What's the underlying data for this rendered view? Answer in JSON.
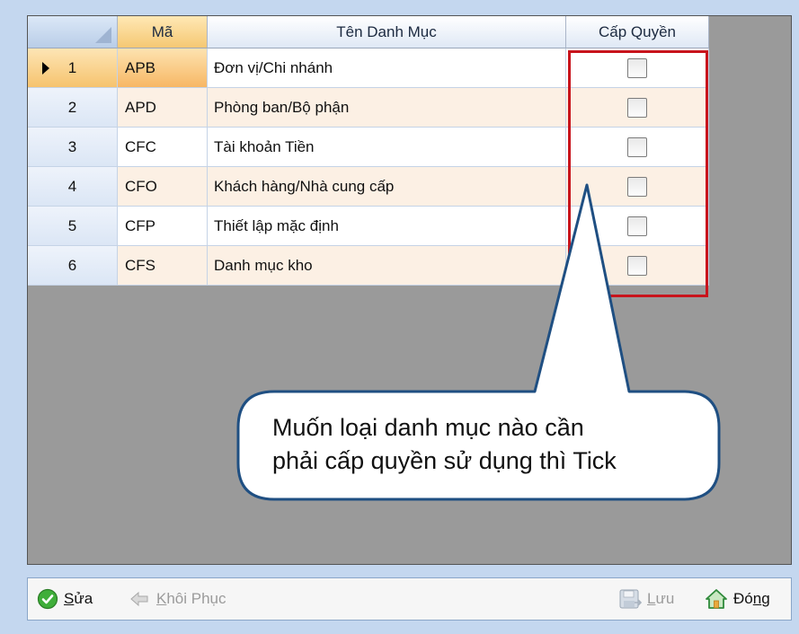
{
  "columns": {
    "ma": "Mã",
    "ten": "Tên Danh Mục",
    "cap_quyen": "Cấp Quyền"
  },
  "rows": [
    {
      "no": "1",
      "ma": "APB",
      "ten": "Đơn vị/Chi nhánh",
      "checked": false,
      "current": true
    },
    {
      "no": "2",
      "ma": "APD",
      "ten": "Phòng ban/Bộ phận",
      "checked": false
    },
    {
      "no": "3",
      "ma": "CFC",
      "ten": "Tài khoản Tiền",
      "checked": false
    },
    {
      "no": "4",
      "ma": "CFO",
      "ten": "Khách hàng/Nhà cung cấp",
      "checked": false
    },
    {
      "no": "5",
      "ma": "CFP",
      "ten": "Thiết lập mặc định",
      "checked": false
    },
    {
      "no": "6",
      "ma": "CFS",
      "ten": "Danh mục kho",
      "checked": false
    }
  ],
  "callout": {
    "line1": "Muốn loại danh mục nào cần",
    "line2": "phải cấp quyền sử dụng thì Tick"
  },
  "toolbar": {
    "edit": {
      "underline": "S",
      "rest": "ửa",
      "icon": "check-circle-icon",
      "enabled": true
    },
    "restore": {
      "underline": "K",
      "rest": "hôi Phục",
      "icon": "back-arrow-icon",
      "enabled": false
    },
    "save": {
      "underline": "L",
      "rest": "ưu",
      "icon": "save-icon",
      "enabled": false
    },
    "close": {
      "pre": "Đó",
      "underline": "n",
      "rest": "g",
      "icon": "home-icon",
      "enabled": true
    }
  },
  "colors": {
    "alt_row": "#fcf0e4",
    "highlight_border": "#c8141c",
    "callout_border": "#1f4f82"
  }
}
